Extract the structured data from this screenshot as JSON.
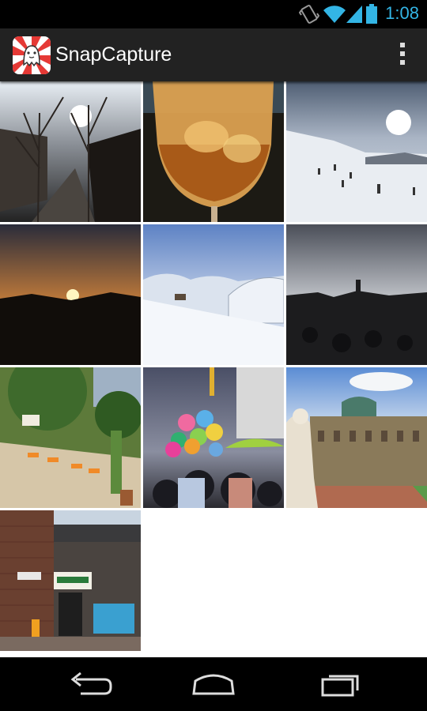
{
  "status_bar": {
    "time": "1:08",
    "icons": [
      "vibrate-icon",
      "wifi-icon",
      "cell-signal-icon",
      "battery-icon"
    ],
    "accent_color": "#33b5e5"
  },
  "action_bar": {
    "title": "SnapCapture",
    "app_icon": "snapcapture-logo-icon",
    "overflow_icon": "overflow-menu-icon"
  },
  "gallery": {
    "photos": [
      {
        "subject": "bare trees on a sunny street at sunset"
      },
      {
        "subject": "glass of orange drink with ice"
      },
      {
        "subject": "snowy ski slope with skiers under sun"
      },
      {
        "subject": "sunset over dark horizon"
      },
      {
        "subject": "snowy hillside with frosted trees"
      },
      {
        "subject": "silhouetted crowd and statue at dusk"
      },
      {
        "subject": "beach bar with deck chairs and palms"
      },
      {
        "subject": "crowd with colorful balloons and umbrella"
      },
      {
        "subject": "baroque palace with statue"
      },
      {
        "subject": "brick railway underpass with shop sign"
      }
    ]
  },
  "nav_bar": {
    "buttons": [
      "back-icon",
      "home-icon",
      "recent-apps-icon"
    ]
  }
}
